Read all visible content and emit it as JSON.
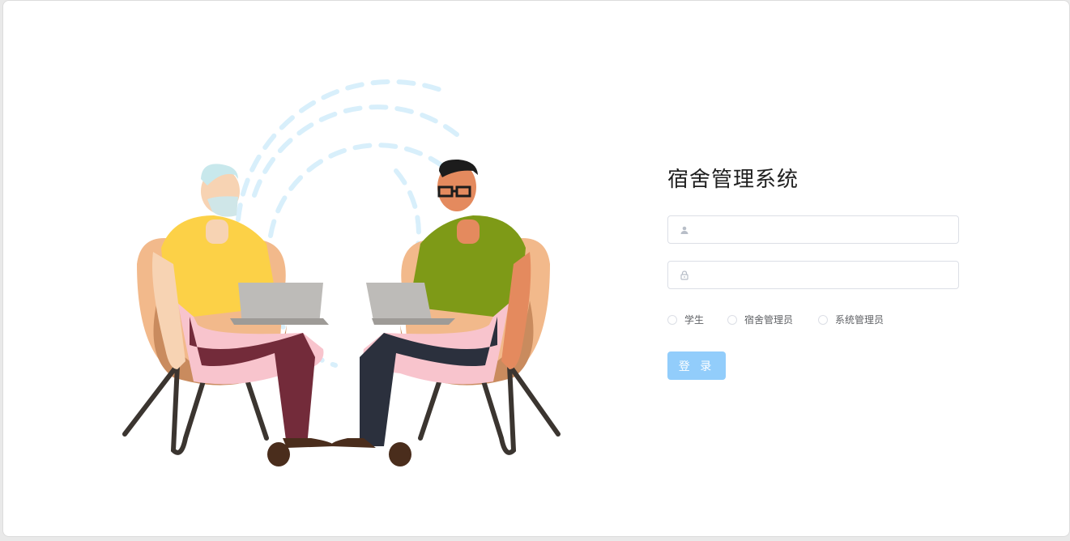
{
  "login": {
    "title": "宿舍管理系统",
    "username": {
      "value": "",
      "placeholder": "",
      "icon": "user-icon"
    },
    "password": {
      "value": "",
      "placeholder": "",
      "icon": "lock-icon"
    },
    "roles": [
      {
        "label": "学生",
        "selected": false
      },
      {
        "label": "宿舍管理员",
        "selected": false
      },
      {
        "label": "系统管理员",
        "selected": false
      }
    ],
    "submit_label": "登 录"
  },
  "colors": {
    "accent": "#92cdfb",
    "border": "#dcdfe6"
  }
}
